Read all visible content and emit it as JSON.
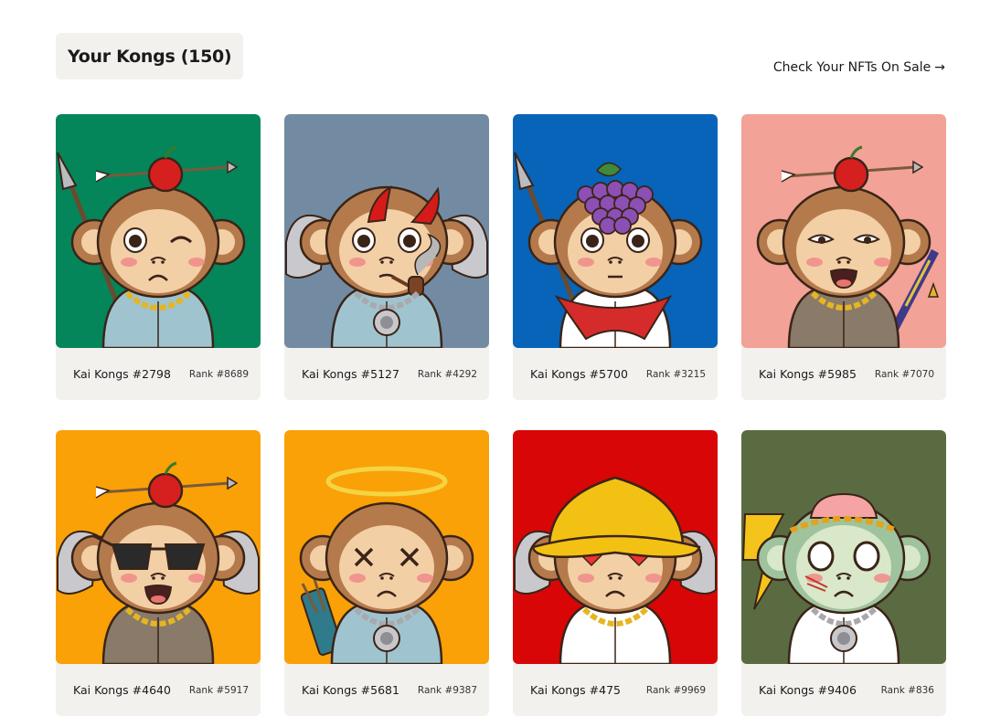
{
  "header": {
    "title": "Your Kongs (150)",
    "sale_link": "Check Your NFTs On Sale",
    "sale_arrow": "→"
  },
  "nfts": [
    {
      "name": "Kai Kongs #2798",
      "rank": "Rank #8689",
      "bg": "#05855a",
      "topper": "apple-arrow",
      "eyes": "wink",
      "mouth": "frown",
      "outfit": "#9fc4cf",
      "accessory": "gold-chain",
      "prop": "spear"
    },
    {
      "name": "Kai Kongs #5127",
      "rank": "Rank #4292",
      "bg": "#738ba2",
      "topper": "devil-horns",
      "eyes": "open",
      "mouth": "pipe",
      "outfit": "#9fc4cf",
      "accessory": "silver-chain",
      "prop": "axe"
    },
    {
      "name": "Kai Kongs #5700",
      "rank": "Rank #3215",
      "bg": "#0764b8",
      "topper": "grapes",
      "eyes": "open",
      "mouth": "flat",
      "outfit": "#ffffff",
      "accessory": "red-bandana",
      "prop": "spear"
    },
    {
      "name": "Kai Kongs #5985",
      "rank": "Rank #7070",
      "bg": "#f2a297",
      "topper": "apple-arrow",
      "eyes": "sleepy",
      "mouth": "open",
      "outfit": "#8a7a69",
      "accessory": "gold-chain",
      "prop": "katana"
    },
    {
      "name": "Kai Kongs #4640",
      "rank": "Rank #5917",
      "bg": "#f9a106",
      "topper": "apple-arrow",
      "eyes": "sunglasses",
      "mouth": "open",
      "outfit": "#8a7a69",
      "accessory": "gold-chain",
      "prop": "axe"
    },
    {
      "name": "Kai Kongs #5681",
      "rank": "Rank #9387",
      "bg": "#f9a106",
      "topper": "halo",
      "eyes": "x",
      "mouth": "frown",
      "outfit": "#9fc4cf",
      "accessory": "silver-chain",
      "prop": "quiver"
    },
    {
      "name": "Kai Kongs #475",
      "rank": "Rank #9969",
      "bg": "#d80606",
      "topper": "bucket-hat",
      "eyes": "hearts",
      "mouth": "frown",
      "outfit": "#ffffff",
      "accessory": "gold-chain",
      "prop": "axe"
    },
    {
      "name": "Kai Kongs #9406",
      "rank": "Rank #836",
      "bg": "#5a6b41",
      "topper": "laurel-brain",
      "eyes": "zombie",
      "mouth": "frown",
      "outfit": "#ffffff",
      "accessory": "silver-chain",
      "prop": "lightning"
    }
  ]
}
